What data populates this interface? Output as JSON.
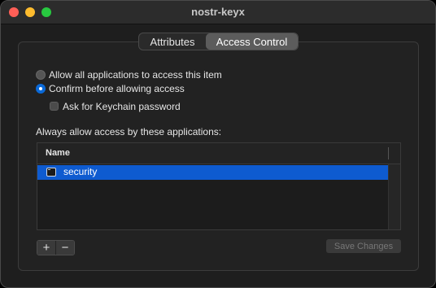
{
  "window": {
    "title": "nostr-keyx"
  },
  "tabs": [
    {
      "label": "Attributes",
      "selected": false
    },
    {
      "label": "Access Control",
      "selected": true
    }
  ],
  "access": {
    "option_allow_all": "Allow all applications to access this item",
    "option_confirm": "Confirm before allowing access",
    "selected_option": "confirm",
    "ask_keychain_password": "Ask for Keychain password",
    "ask_keychain_password_checked": false,
    "always_allow_label": "Always allow access by these applications:"
  },
  "app_table": {
    "column_header": "Name",
    "rows": [
      {
        "name": "security",
        "selected": true,
        "icon": "terminal-app-icon"
      }
    ]
  },
  "buttons": {
    "add": "+",
    "remove": "−",
    "save": "Save Changes",
    "save_enabled": false
  },
  "colors": {
    "selection": "#0e5bd0",
    "radio_selected": "#0a69d8",
    "close": "#ff5f57",
    "minimize": "#febc2e",
    "zoom": "#28c840"
  }
}
